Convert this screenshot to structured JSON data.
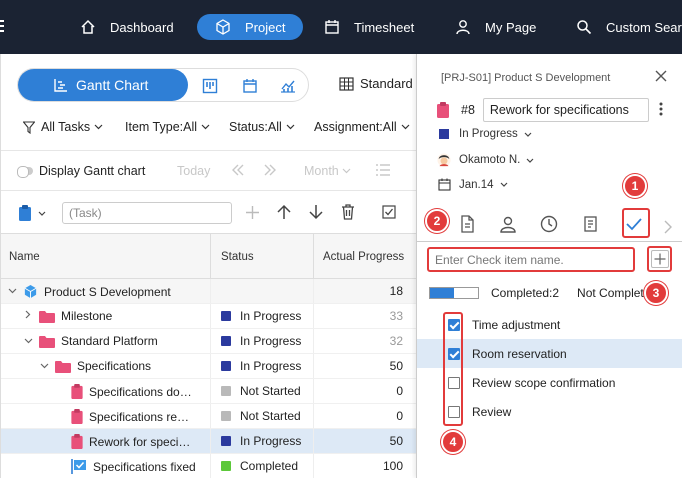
{
  "nav": {
    "items": [
      {
        "label": "Dashboard",
        "icon": "home-icon",
        "active": false
      },
      {
        "label": "Project",
        "icon": "cube-icon",
        "active": true
      },
      {
        "label": "Timesheet",
        "icon": "calendar-icon",
        "active": false
      },
      {
        "label": "My Page",
        "icon": "user-icon",
        "active": false
      },
      {
        "label": "Custom Sear",
        "icon": "search-icon",
        "active": false
      }
    ]
  },
  "toolbar": {
    "gantt_label": "Gantt Chart",
    "standard_label": "Standard",
    "filters": [
      "All Tasks",
      "Item Type:All",
      "Status:All",
      "Assignment:All"
    ],
    "display_gantt_label": "Display Gantt chart",
    "today_label": "Today",
    "month_label": "Month",
    "task_placeholder": "(Task)"
  },
  "table": {
    "headers": {
      "name": "Name",
      "status": "Status",
      "progress": "Actual Progress"
    },
    "rows": [
      {
        "name": "Product S Development",
        "status": "",
        "status_color": "",
        "progress": "18",
        "level": 0,
        "caret": "down",
        "icon": "project",
        "selected": false
      },
      {
        "name": "Milestone",
        "status": "In Progress",
        "status_color": "#2b3a9e",
        "progress": "33",
        "level": 1,
        "caret": "right",
        "icon": "folder",
        "selected": false,
        "muted": true
      },
      {
        "name": "Standard Platform",
        "status": "In Progress",
        "status_color": "#2b3a9e",
        "progress": "32",
        "level": 1,
        "caret": "down",
        "icon": "folder",
        "selected": false,
        "muted": true
      },
      {
        "name": "Specifications",
        "status": "In Progress",
        "status_color": "#2b3a9e",
        "progress": "50",
        "level": 2,
        "caret": "down",
        "icon": "folder-open",
        "selected": false
      },
      {
        "name": "Specifications do…",
        "status": "Not Started",
        "status_color": "#b9b9b9",
        "progress": "0",
        "level": 3,
        "caret": "",
        "icon": "task",
        "selected": false
      },
      {
        "name": "Specifications re…",
        "status": "Not Started",
        "status_color": "#b9b9b9",
        "progress": "0",
        "level": 3,
        "caret": "",
        "icon": "task",
        "selected": false
      },
      {
        "name": "Rework for speci…",
        "status": "In Progress",
        "status_color": "#2b3a9e",
        "progress": "50",
        "level": 3,
        "caret": "",
        "icon": "task",
        "selected": true
      },
      {
        "name": "Specifications fixed",
        "status": "Completed",
        "status_color": "#5cc83a",
        "progress": "100",
        "level": 3,
        "caret": "",
        "icon": "milestone",
        "selected": false
      }
    ]
  },
  "panel": {
    "path": "[PRJ-S01] Product S Development",
    "number": "#8",
    "title": "Rework for specifications",
    "status": "In Progress",
    "status_color": "#2b3a9e",
    "assignee": "Okamoto N.",
    "date": "Jan.14",
    "check_placeholder": "Enter Check item name.",
    "completed_label": "Completed:2",
    "not_completed_label": "Not Complete",
    "progress": 0.5,
    "checklist": [
      {
        "label": "Time adjustment",
        "checked": true,
        "selected": false
      },
      {
        "label": "Room reservation",
        "checked": true,
        "selected": true
      },
      {
        "label": "Review scope confirmation",
        "checked": false,
        "selected": false
      },
      {
        "label": "Review",
        "checked": false,
        "selected": false
      }
    ]
  },
  "callouts": [
    "1",
    "2",
    "3",
    "4"
  ],
  "colors": {
    "nav_bg": "#1b2333",
    "accent": "#2f7fd6",
    "callout": "#e23b3b",
    "task_pink": "#e8507a"
  }
}
